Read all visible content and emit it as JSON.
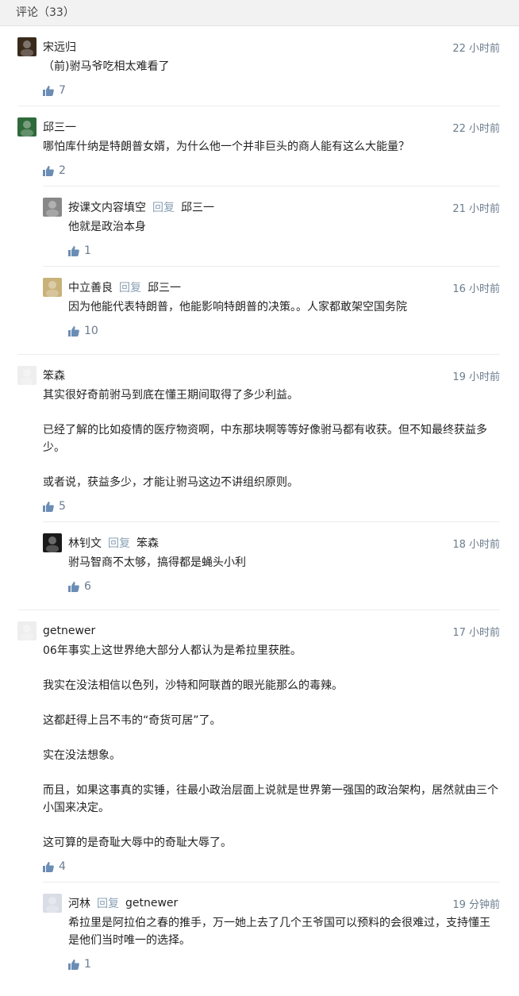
{
  "header": {
    "title": "评论（33）"
  },
  "comments": [
    {
      "name": "宋远归",
      "time": "22 小时前",
      "paragraphs": [
        "（前)驸马爷吃相太难看了"
      ],
      "likes": "7",
      "avatar_color": "#3a2a1c",
      "replies": []
    },
    {
      "name": "邱三一",
      "time": "22 小时前",
      "paragraphs": [
        "哪怕库什纳是特朗普女婿，为什么他一个并非巨头的商人能有这么大能量？"
      ],
      "likes": "2",
      "avatar_color": "#2f6a3a",
      "replies": [
        {
          "name": "按课文内容填空",
          "reply_word": "回复",
          "reply_target": "邱三一",
          "time": "21 小时前",
          "paragraphs": [
            "他就是政治本身"
          ],
          "likes": "1",
          "avatar_color": "#888888"
        },
        {
          "name": "中立善良",
          "reply_word": "回复",
          "reply_target": "邱三一",
          "time": "16 小时前",
          "paragraphs": [
            "因为他能代表特朗普，他能影响特朗普的决策。。人家都敢架空国务院"
          ],
          "likes": "10",
          "avatar_color": "#c9b27a"
        }
      ]
    },
    {
      "name": "笨森",
      "time": "19 小时前",
      "paragraphs": [
        "其实很好奇前驸马到底在懂王期间取得了多少利益。",
        "已经了解的比如疫情的医疗物资啊，中东那块啊等等好像驸马都有收获。但不知最终获益多少。",
        "或者说，获益多少，才能让驸马这边不讲组织原则。"
      ],
      "likes": "5",
      "avatar_color": "#eeeeee",
      "replies": [
        {
          "name": "林钊文",
          "reply_word": "回复",
          "reply_target": "笨森",
          "time": "18 小时前",
          "paragraphs": [
            "驸马智商不太够，搞得都是蝇头小利"
          ],
          "likes": "6",
          "avatar_color": "#1a1a1a"
        }
      ]
    },
    {
      "name": "getnewer",
      "time": "17 小时前",
      "paragraphs": [
        "06年事实上这世界绝大部分人都认为是希拉里获胜。",
        "我实在没法相信以色列，沙特和阿联酋的眼光能那么的毒辣。",
        "这都赶得上吕不韦的“奇货可居”了。",
        "实在没法想象。",
        "而且，如果这事真的实锤，往最小政治层面上说就是世界第一强国的政治架构，居然就由三个小国来决定。",
        "这可算的是奇耻大辱中的奇耻大辱了。"
      ],
      "likes": "4",
      "avatar_color": "#eeeeee",
      "replies": [
        {
          "name": "河林",
          "reply_word": "回复",
          "reply_target": "getnewer",
          "time": "19 分钟前",
          "paragraphs": [
            "希拉里是阿拉伯之春的推手，万一她上去了几个王爷国可以预料的会很难过，支持懂王是他们当时唯一的选择。"
          ],
          "likes": "1",
          "avatar_color": "#d8dde6"
        }
      ]
    }
  ]
}
